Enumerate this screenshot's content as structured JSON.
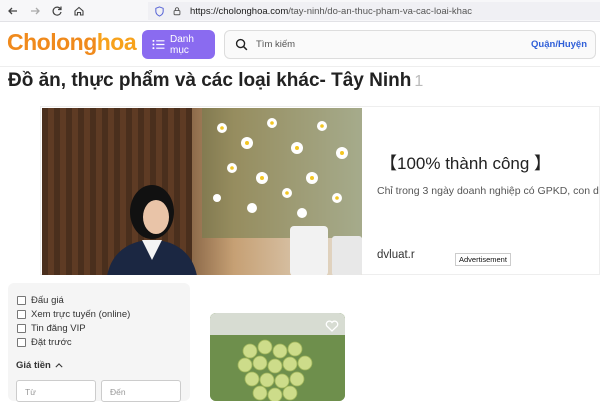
{
  "browser": {
    "url_host": "https://cholonghoa.com",
    "url_path": "/tay-ninh/do-an-thuc-pham-va-cac-loai-khac"
  },
  "header": {
    "logo_main": "Cholong",
    "logo_accent": "hoa",
    "menu_label": "Danh mục",
    "search_placeholder": "Tìm kiếm",
    "district_label": "Quận/Huyện"
  },
  "page": {
    "title": "Đồ ăn, thực phẩm và các loại khác- Tây Ninh",
    "count": "1"
  },
  "ad": {
    "headline": "【100% thành công 】",
    "description": "Chỉ trong 3 ngày doanh nghiệp có GPKD, con d",
    "domain": "dvluat.r",
    "tag": "Advertisement"
  },
  "filter": {
    "options": [
      "Đấu giá",
      "Xem trực tuyến (online)",
      "Tin đăng VIP",
      "Đặt trước"
    ],
    "price_heading": "Giá tiền",
    "price_from_placeholder": "Từ",
    "price_to_placeholder": "Đến"
  },
  "colors": {
    "brand_orange": "#f08a1c",
    "menu_purple": "#8a6bf0",
    "district_blue": "#2f5fd8"
  }
}
